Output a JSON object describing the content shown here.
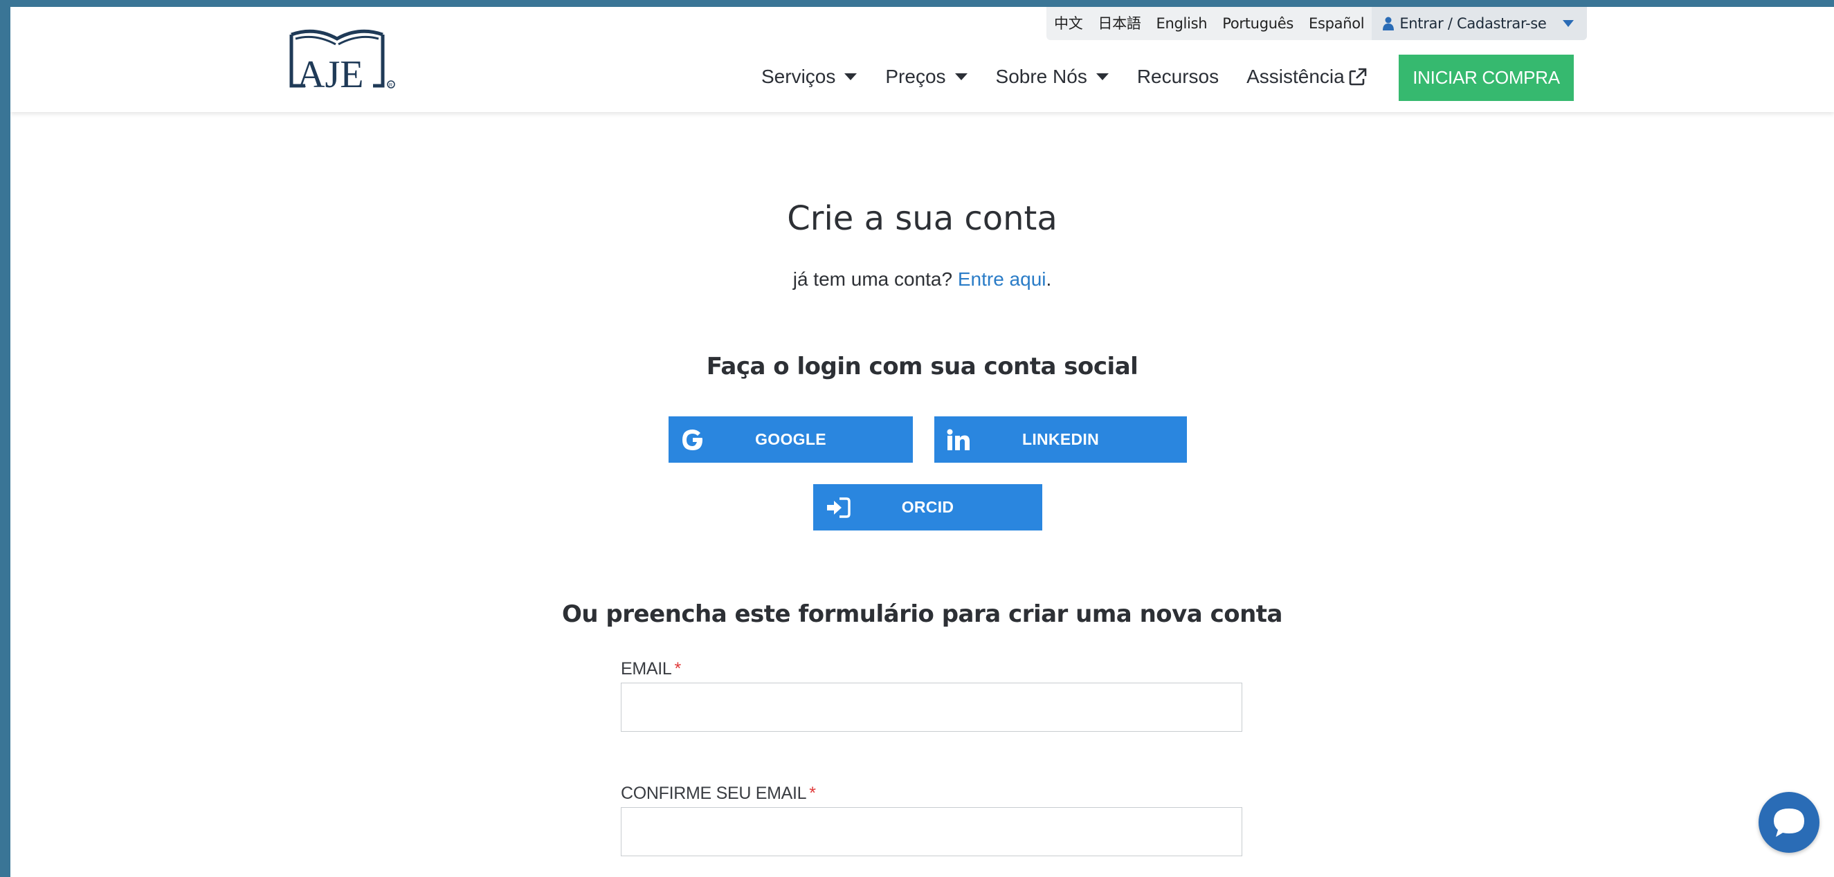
{
  "header": {
    "logo_text": "AJE",
    "languages": [
      "中文",
      "日本語",
      "English",
      "Português",
      "Español"
    ],
    "account_label": "Entrar / Cadastrar-se",
    "nav": [
      {
        "label": "Serviços",
        "has_dropdown": true
      },
      {
        "label": "Preços",
        "has_dropdown": true
      },
      {
        "label": "Sobre Nós",
        "has_dropdown": true
      },
      {
        "label": "Recursos",
        "has_dropdown": false
      },
      {
        "label": "Assistência",
        "has_dropdown": false,
        "icon": "external-link-icon"
      }
    ],
    "cta_label": "INICIAR COMPRA"
  },
  "main": {
    "title": "Crie a sua conta",
    "already_text": "já tem uma conta?",
    "login_link": "Entre aqui",
    "login_suffix": ".",
    "social_title": "Faça o login com sua conta social",
    "social_buttons": [
      {
        "label": "GOOGLE",
        "icon": "google-icon"
      },
      {
        "label": "LINKEDIN",
        "icon": "linkedin-icon"
      },
      {
        "label": "ORCID",
        "icon": "sign-in-icon"
      }
    ],
    "form_title": "Ou preencha este formulário para criar uma nova conta",
    "fields": [
      {
        "label": "EMAIL",
        "required_mark": "*",
        "value": "",
        "placeholder": ""
      },
      {
        "label": "CONFIRME SEU EMAIL",
        "required_mark": "*",
        "value": "",
        "placeholder": ""
      }
    ]
  },
  "colors": {
    "frame": "#3a7596",
    "cta": "#36b96f",
    "social_button": "#2a86df",
    "link": "#2a7cc7",
    "required": "#e03a3a",
    "chat": "#2a6cb6"
  },
  "chat_widget": {
    "icon": "chat-bubble-icon"
  }
}
